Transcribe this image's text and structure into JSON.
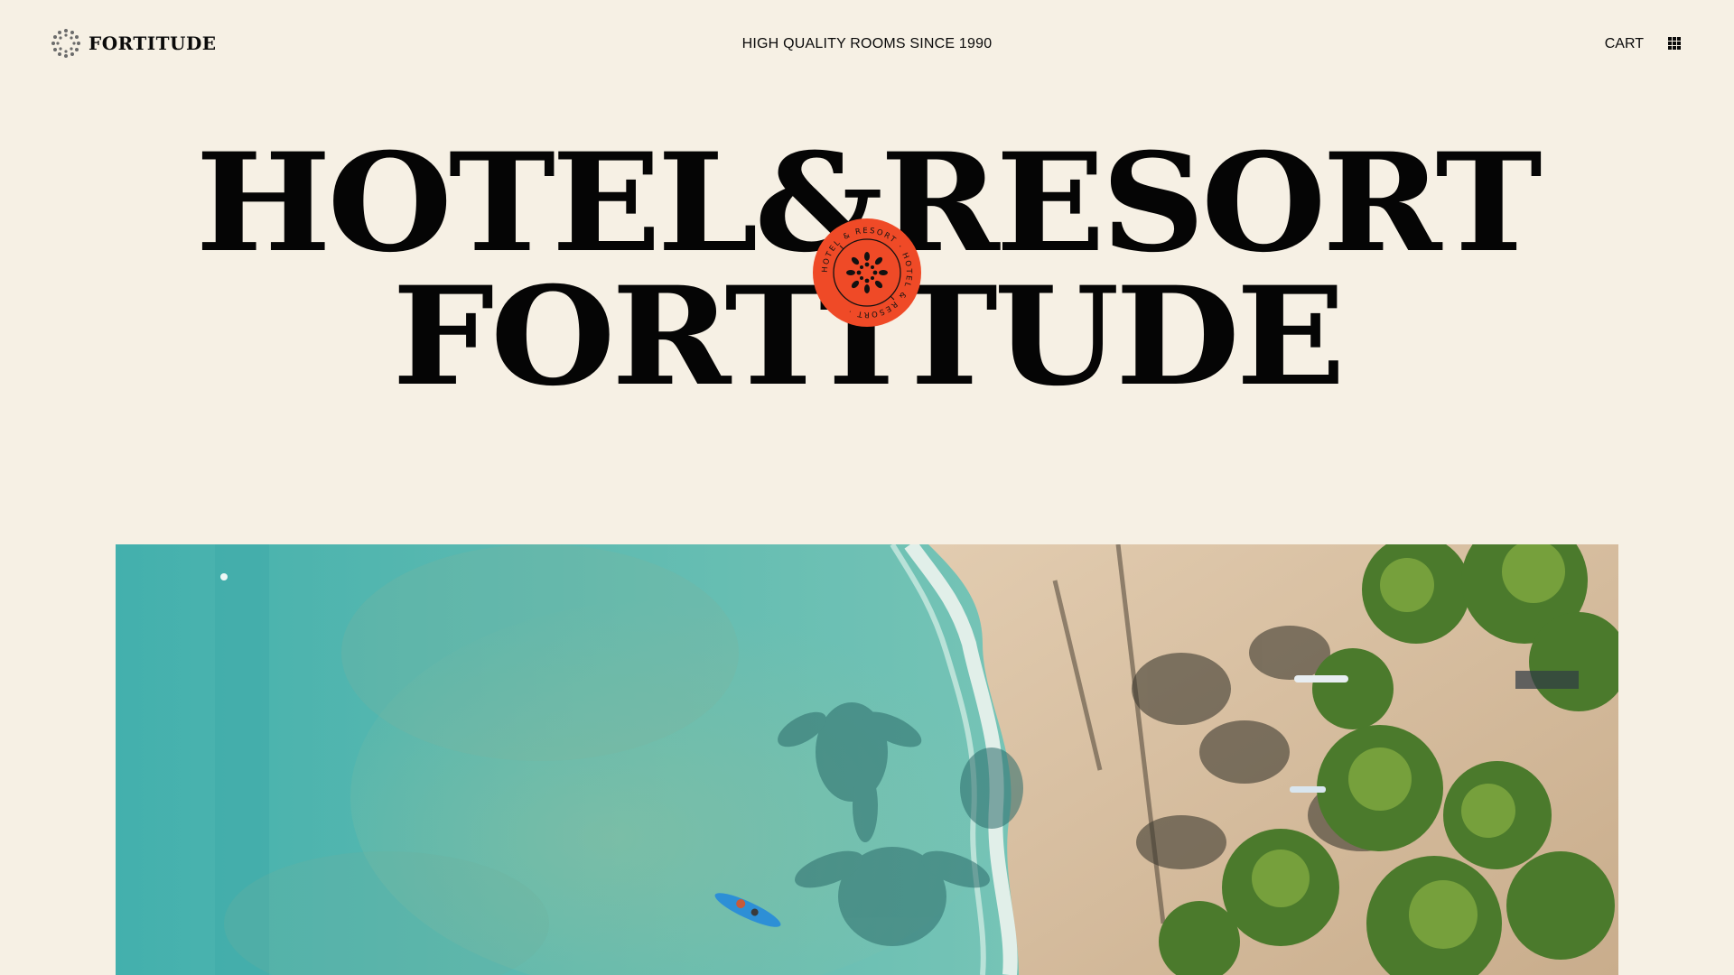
{
  "header": {
    "brand_name": "FORTITUDE",
    "brand_logo_icon": "sunburst-logo-icon",
    "tagline": "HIGH QUALITY ROOMS SINCE 1990",
    "cart_label": "CART",
    "menu_icon": "grid-menu-icon"
  },
  "hero": {
    "title_line1": "HOTEL&RESORT",
    "title_line2": "FORTITUDE",
    "badge": {
      "ring_text": "HOTEL & RESORT · HOTEL & RESORT · ",
      "center_icon": "sunburst-icon",
      "color": "#ef4a27"
    },
    "image": {
      "description_icon": "aerial-beach-image"
    }
  },
  "colors": {
    "background": "#f6f0e4",
    "text": "#0a0a0a",
    "accent": "#ef4a27",
    "sea": "#5bb7ad",
    "sand": "#d9c2a4"
  }
}
